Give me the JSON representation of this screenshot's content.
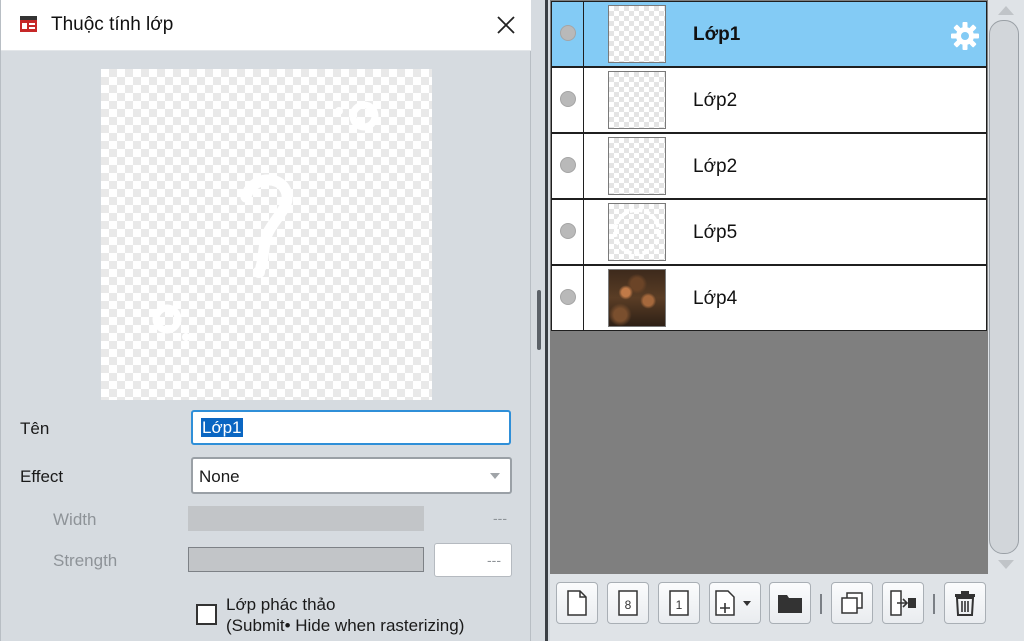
{
  "dialog": {
    "title": "Thuộc tính lớp",
    "fields": {
      "name_label": "Tên",
      "name_value": "Lớp1",
      "effect_label": "Effect",
      "effect_value": "None",
      "width_label": "Width",
      "width_value": "---",
      "strength_label": "Strength",
      "strength_value": "---"
    },
    "checkbox": {
      "label_line1": "Lớp phác thảo",
      "label_line2": "(Submit• Hide when rasterizing)",
      "checked": false
    }
  },
  "layers_panel": {
    "layers": [
      {
        "name": "Lớp1",
        "active": true,
        "thumb": "transparent"
      },
      {
        "name": "Lớp2",
        "active": false,
        "thumb": "transparent"
      },
      {
        "name": "Lớp2",
        "active": false,
        "thumb": "transparent"
      },
      {
        "name": "Lớp5",
        "active": false,
        "thumb": "circle-outline"
      },
      {
        "name": "Lớp4",
        "active": false,
        "thumb": "photo"
      }
    ],
    "colors": {
      "active_row": "#83cbf5",
      "empty_area": "#7f7f7f"
    },
    "toolbar": [
      "new-layer-icon",
      "layer-8bit-icon",
      "layer-1bit-icon",
      "add-layer-dropdown-icon",
      "folder-icon",
      "duplicate-layer-icon",
      "merge-down-icon",
      "trash-icon"
    ]
  }
}
